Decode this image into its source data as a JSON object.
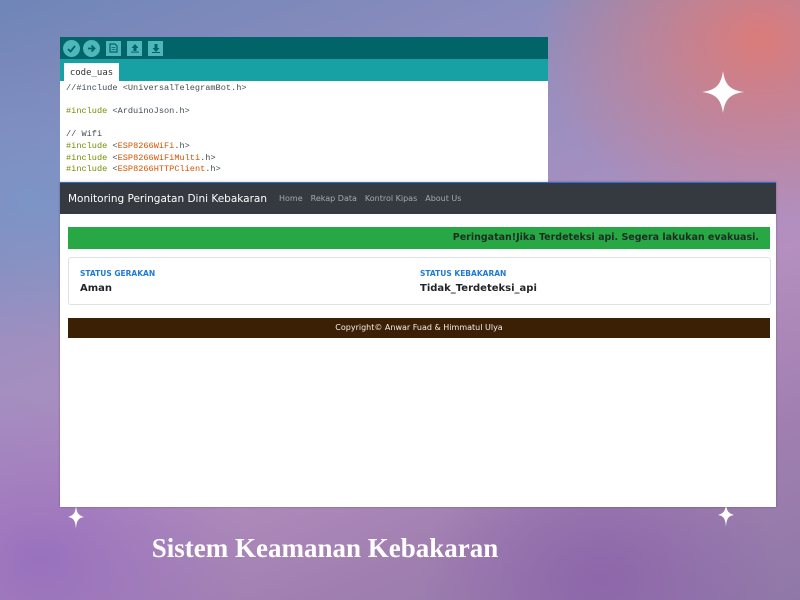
{
  "ide": {
    "tab_label": "code_uas",
    "code_lines": [
      {
        "pre": "//#include <",
        "lib": "",
        "mid": "UniversalTelegramBot.h",
        "post": ">",
        "type": "comment"
      },
      {
        "pre": "",
        "lib": "",
        "mid": "",
        "post": "",
        "type": "blank"
      },
      {
        "pre": "#include",
        "lib": "",
        "mid": " <ArduinoJson.h>",
        "post": "",
        "type": "include_plain"
      },
      {
        "pre": "",
        "lib": "",
        "mid": "",
        "post": "",
        "type": "blank"
      },
      {
        "pre": "// Wifi",
        "lib": "",
        "mid": "",
        "post": "",
        "type": "comment"
      },
      {
        "pre": "#include",
        "lib": "ESP8266WiFi",
        "mid": ".h",
        "post": ">",
        "type": "include_lib"
      },
      {
        "pre": "#include",
        "lib": "ESP8266WiFiMulti",
        "mid": ".h",
        "post": ">",
        "type": "include_lib"
      },
      {
        "pre": "#include",
        "lib": "ESP8266HTTPClient",
        "mid": ".h",
        "post": ">",
        "type": "include_lib"
      }
    ],
    "toolbar_icons": [
      "verify-icon",
      "upload-icon",
      "new-icon",
      "open-icon",
      "save-icon"
    ]
  },
  "web": {
    "brand": "Monitoring Peringatan Dini Kebakaran",
    "nav": [
      "Home",
      "Rekap Data",
      "Kontrol Kipas",
      "About Us"
    ],
    "alert": "Peringatan!Jika Terdeteksi api. Segera lakukan evakuasi.",
    "status": {
      "gerakan_label": "STATUS GERAKAN",
      "gerakan_value": "Aman",
      "kebakaran_label": "STATUS KEBAKARAN",
      "kebakaran_value": "Tidak_Terdeteksi_api"
    },
    "footer": "Copyright© Anwar Fuad & Himmatul Ulya"
  },
  "caption": "Sistem Keamanan Kebakaran",
  "colors": {
    "ide_toolbar": "#006468",
    "ide_tabbar": "#17a1a5",
    "navbar": "#343a40",
    "alert": "#28a745",
    "status_label": "#1f7ad6",
    "footer": "#3b2006"
  }
}
